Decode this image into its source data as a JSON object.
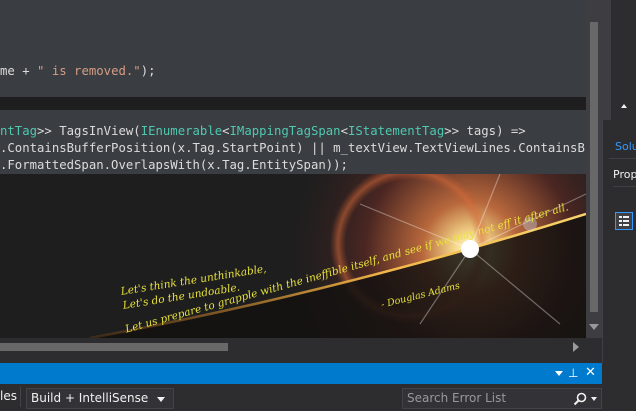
{
  "editor": {
    "line1": {
      "prefix": "me + ",
      "string": "\" is removed.\"",
      "suffix": ");"
    },
    "line2": {
      "t1": "ntTag",
      "t2": ">> TagsInView(",
      "t3": "IEnumerable",
      "t4": "<",
      "t5": "IMappingTagSpan",
      "t6": "<",
      "t7": "IStatementTag",
      "t8": ">> tags) =>"
    },
    "line3": ".ContainsBufferPosition(x.Tag.StartPoint) || m_textView.TextViewLines.ContainsBuffer",
    "line4": ".FormattedSpan.OverlapsWith(x.Tag.EntitySpan));"
  },
  "background_art": {
    "quote_lines": [
      "Let's think the unthinkable,",
      "Let's do the undoable.",
      "Let us prepare to grapple with the ineffible itself, and see if we may not eff it after all."
    ],
    "attribution": "- Douglas Adams"
  },
  "right_panel": {
    "solution_tab": "Solu",
    "properties_tab": "Prop"
  },
  "error_list": {
    "left_tab": "les",
    "scope_dropdown": "Build + IntelliSense",
    "search_placeholder": "Search Error List"
  },
  "colors": {
    "accent": "#007acc",
    "editor_bg": "#1e1e1e",
    "quote_text": "#e8e23a"
  }
}
